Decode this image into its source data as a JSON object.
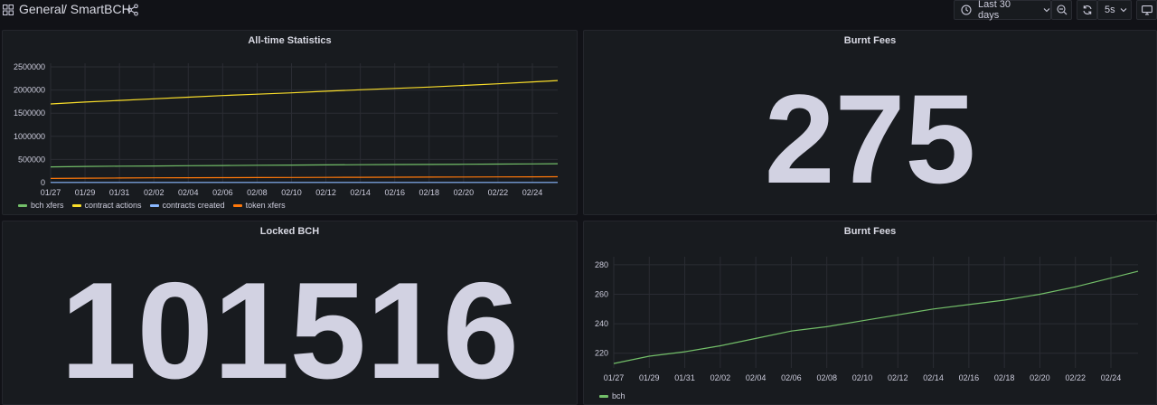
{
  "topbar": {
    "folder": "General",
    "dashboard": "/ SmartBCH",
    "time_range": "Last 30 days",
    "refresh_interval": "5s"
  },
  "panels": {
    "alltime": {
      "title": "All-time Statistics"
    },
    "burnt_stat": {
      "title": "Burnt Fees",
      "value": "275"
    },
    "locked": {
      "title": "Locked BCH",
      "value": "101516"
    },
    "burnt_chart": {
      "title": "Burnt Fees"
    }
  },
  "colors": {
    "green": "#73bf69",
    "yellow": "#fade2a",
    "blue": "#8ab8ff",
    "orange": "#ff780a"
  },
  "chart_data": [
    {
      "type": "line",
      "title": "All-time Statistics",
      "x": [
        "01/27",
        "01/29",
        "01/31",
        "02/02",
        "02/04",
        "02/06",
        "02/08",
        "02/10",
        "02/12",
        "02/14",
        "02/16",
        "02/18",
        "02/20",
        "02/22",
        "02/24"
      ],
      "yticks": [
        "0",
        "500000",
        "1000000",
        "1500000",
        "2000000",
        "2500000"
      ],
      "ylim": [
        0,
        2500000
      ],
      "legend_position": "bottom-left",
      "series": [
        {
          "name": "bch xfers",
          "color": "#73bf69",
          "values": [
            340000,
            350000,
            355000,
            360000,
            365000,
            370000,
            375000,
            378000,
            382000,
            386000,
            390000,
            393000,
            397000,
            400000,
            405000
          ]
        },
        {
          "name": "contract actions",
          "color": "#fade2a",
          "values": [
            1700000,
            1740000,
            1775000,
            1810000,
            1845000,
            1880000,
            1910000,
            1940000,
            1975000,
            2005000,
            2035000,
            2065000,
            2100000,
            2135000,
            2175000
          ]
        },
        {
          "name": "contracts created",
          "color": "#8ab8ff",
          "values": [
            4000,
            4000,
            4000,
            4000,
            4000,
            4000,
            4000,
            4000,
            4000,
            4000,
            4000,
            4000,
            4000,
            4000,
            4000
          ]
        },
        {
          "name": "token xfers",
          "color": "#ff780a",
          "values": [
            90000,
            95000,
            100000,
            103000,
            105000,
            107000,
            109000,
            111000,
            113000,
            115000,
            117000,
            119000,
            121000,
            123000,
            125000
          ]
        }
      ]
    },
    {
      "type": "line",
      "title": "Burnt Fees",
      "x": [
        "01/27",
        "01/29",
        "01/31",
        "02/02",
        "02/04",
        "02/06",
        "02/08",
        "02/10",
        "02/12",
        "02/14",
        "02/16",
        "02/18",
        "02/20",
        "02/22",
        "02/24"
      ],
      "yticks": [
        "220",
        "240",
        "260",
        "280"
      ],
      "ylim": [
        210,
        283
      ],
      "legend_position": "bottom-left",
      "series": [
        {
          "name": "bch",
          "color": "#73bf69",
          "values": [
            213,
            218,
            221,
            225,
            230,
            235,
            238,
            242,
            246,
            250,
            253,
            256,
            260,
            265,
            271
          ]
        }
      ]
    }
  ]
}
